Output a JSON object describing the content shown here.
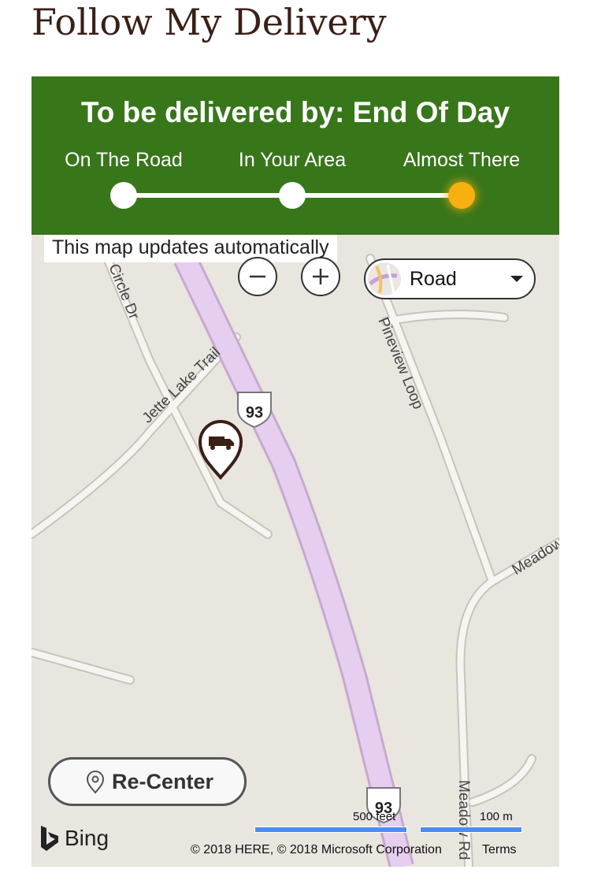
{
  "page": {
    "title": "Follow My Delivery"
  },
  "status": {
    "headline": "To be delivered by: End Of Day",
    "steps": [
      "On The Road",
      "In Your Area",
      "Almost There"
    ],
    "current_step": 3,
    "accent_color": "#38761a",
    "active_color": "#f6b10e"
  },
  "map": {
    "note": "This map updates automatically",
    "style_select": {
      "value": "Road"
    },
    "recenter_label": "Re-Center",
    "road_labels": {
      "circle": "Circle Dr",
      "jette": "Jette Lake Trail",
      "pineview": "Pineview Loop",
      "meadow_1": "Meadow",
      "meadow_2": "Meadow Rd",
      "highway_shield": "93"
    },
    "scale": {
      "feet": "500 feet",
      "meters": "100 m"
    },
    "attribution": "© 2018 HERE, © 2018 Microsoft Corporation",
    "terms_link": "Terms",
    "provider": "Bing"
  }
}
